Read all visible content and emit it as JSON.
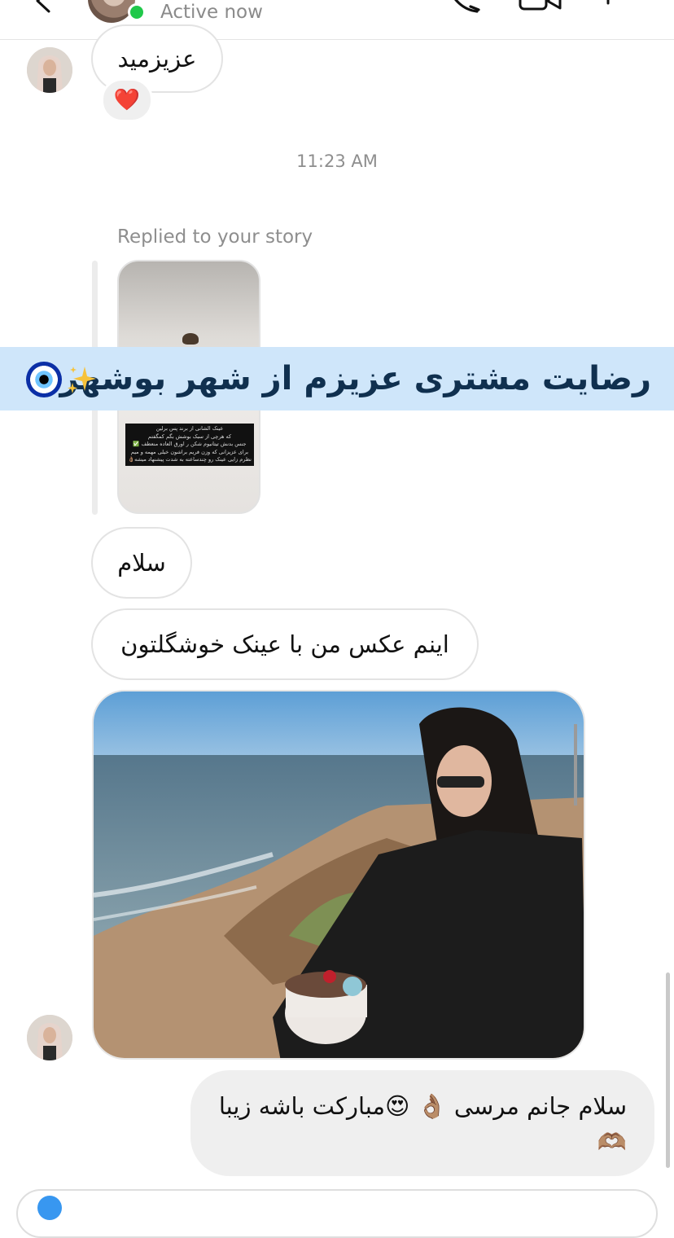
{
  "header": {
    "status": "Active now",
    "icons": [
      "back-chevron-icon",
      "phone-icon",
      "video-camera-icon",
      "info-icon"
    ],
    "status_color": "#20c84a"
  },
  "messages": {
    "m1_text": "عزیزمید",
    "m1_reaction": "❤️",
    "timestamp": "11:23 AM",
    "replied_label": "Replied to your story",
    "story_caption_lines": [
      "عینک الشانی از برند پس برلین",
      "که هرچی از سبک بوشش بگم کمگفتم",
      "جنس بدنش تیتانیوم شکن ر اورق العاده منعطف ✅",
      "برای عزیزانی که وزن فریم براشون خیلی مهمه و میم",
      "نظرم زایی عینک رو چندساعته به شدت پیشنهاد میشه👌🏽"
    ],
    "m2_text": "سلام",
    "m3_text": "اینم عکس من با عینک خوشگلتون",
    "my_reply_line1": "سلام جانم مرسی 👌🏽 😍مبارکت باشه زیبا",
    "my_reply_line2": "🫶🏽"
  },
  "overlay": {
    "banner_text": "رضایت مشتری عزیزم از شهر بوشهر",
    "banner_icons": [
      "sparkles-icon",
      "evil-eye-icon"
    ],
    "banner_color": "#cfe6fa"
  }
}
